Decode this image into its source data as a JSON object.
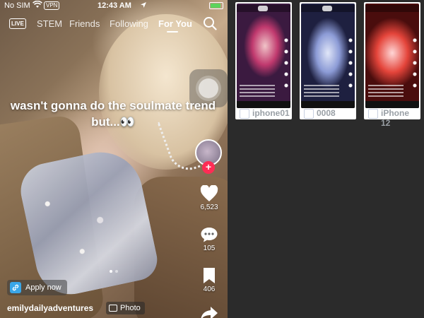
{
  "status_bar": {
    "carrier": "No SIM",
    "vpn": "VPN",
    "time": "12:43 AM",
    "location_icon": "location-arrow-icon",
    "battery_color": "#5dd35d"
  },
  "top_nav": {
    "live_label": "LIVE",
    "tabs": [
      {
        "label": "STEM",
        "active": false
      },
      {
        "label": "Friends",
        "active": false
      },
      {
        "label": "Following",
        "active": false
      },
      {
        "label": "For You",
        "active": true
      }
    ]
  },
  "post": {
    "caption": "wasn't gonna do the soulmate trend but...",
    "emoji": "👀",
    "likes": "6,523",
    "comments": "105",
    "saves": "406",
    "username": "emilydailyadventures",
    "photo_label": "Photo",
    "apply_label": "Apply now",
    "carousel_pages": 2,
    "carousel_current": 1
  },
  "devices": [
    {
      "name": "iphone01"
    },
    {
      "name": "0008"
    },
    {
      "name": "iPhone 12"
    }
  ],
  "colors": {
    "accent_red": "#fe2c55",
    "panel_bg": "#2b2b2b",
    "apply_icon": "#3aa6e8"
  }
}
